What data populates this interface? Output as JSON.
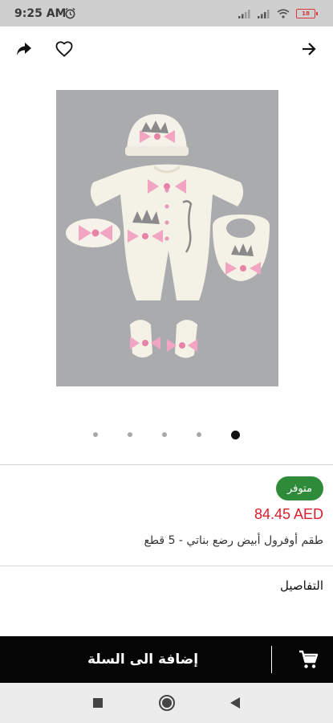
{
  "status_bar": {
    "time": "9:25 AM",
    "battery": "18",
    "icons": [
      "alarm-icon",
      "signal-icon",
      "signal-icon",
      "wifi-icon",
      "battery-icon"
    ]
  },
  "top_bar": {
    "icons": [
      "share-icon",
      "heart-icon",
      "forward-arrow-icon"
    ]
  },
  "gallery": {
    "image": "baby-girl-overall-set-photo",
    "page_count": 5,
    "active_index": 4
  },
  "product": {
    "availability": "متوفر",
    "price": "84.45 AED",
    "name": "طقم أوفرول أبيض رضع بناتي - 5 قطع",
    "details_label": "التفاصيل"
  },
  "cart": {
    "label": "إضافة الى السلة",
    "icon": "cart-icon"
  },
  "system_nav": {
    "icons": [
      "recent-apps-icon",
      "home-icon",
      "back-icon"
    ]
  },
  "colors": {
    "price": "#d81e2b",
    "availability_badge": "#2e8b3a",
    "cart_bar": "#050505"
  }
}
